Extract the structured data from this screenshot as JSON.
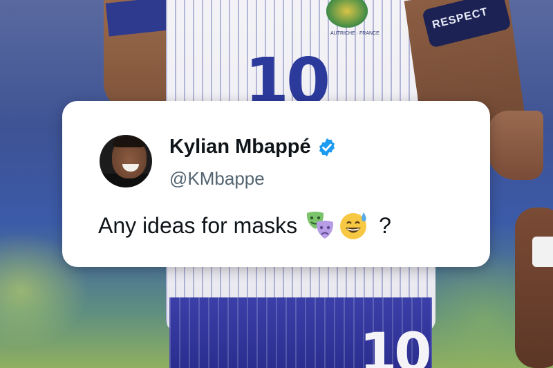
{
  "background": {
    "jersey_number_top": "10",
    "jersey_number_bottom": "10",
    "armband_text": "RESPECT",
    "badge_caption": "AUTRICHE · FRANCE"
  },
  "tweet": {
    "name": "Kylian Mbappé",
    "handle": "@KMbappe",
    "verified": true,
    "text": "Any ideas for masks",
    "emoji": [
      "performing-arts-masks",
      "grinning-sweat-face"
    ],
    "trailing_text": "?"
  },
  "colors": {
    "verified_blue": "#1d9bf0",
    "name_text": "#0f1419",
    "handle_text": "#536471",
    "card_bg": "#ffffff"
  }
}
